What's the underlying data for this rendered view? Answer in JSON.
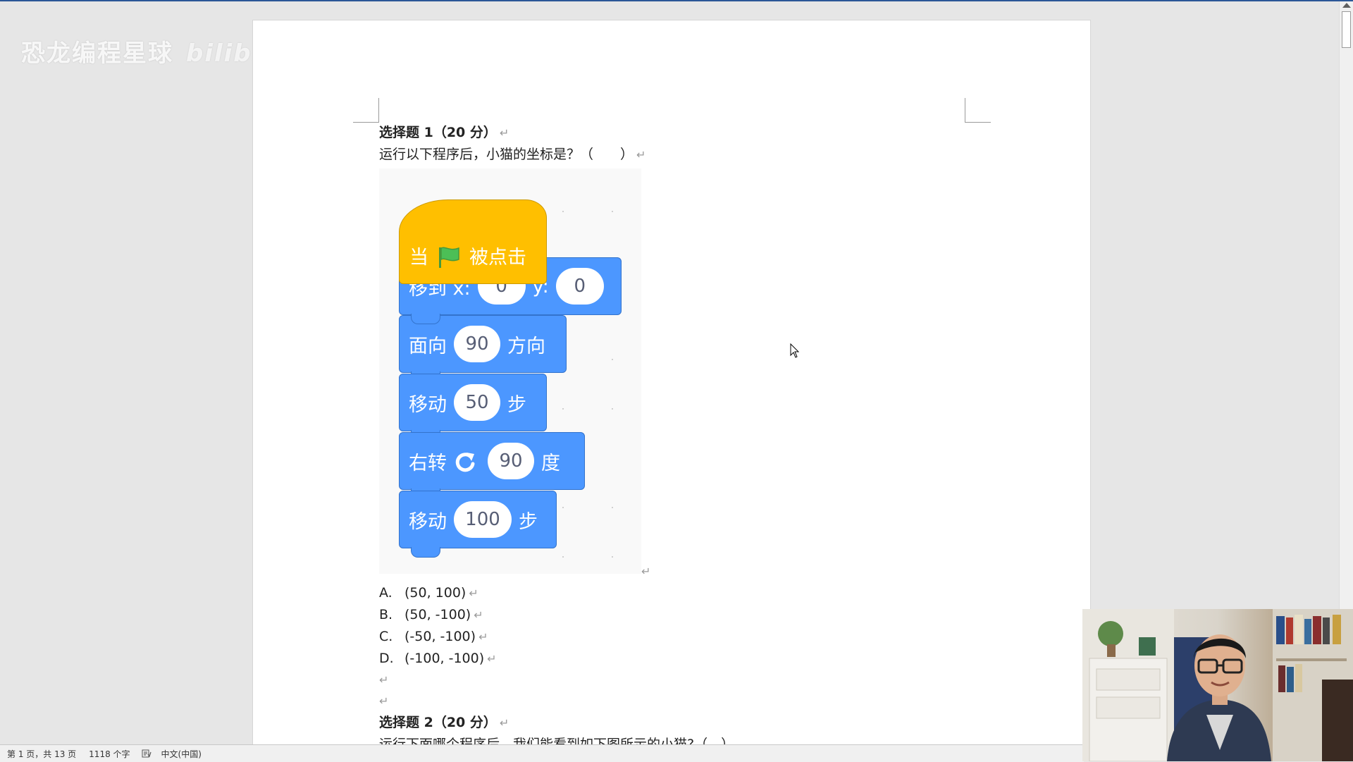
{
  "watermark": {
    "text": "恐龙编程星球",
    "logo": "bilibili"
  },
  "question1": {
    "title": "选择题 1（20 分）",
    "text": "运行以下程序后，小猫的坐标是？（　　）",
    "blocks": {
      "when_flag": {
        "prefix": "当",
        "suffix": "被点击"
      },
      "goto": {
        "label_x": "移到 x:",
        "x": "0",
        "label_y": "y:",
        "y": "0"
      },
      "point": {
        "prefix": "面向",
        "value": "90",
        "suffix": "方向"
      },
      "move1": {
        "prefix": "移动",
        "value": "50",
        "suffix": "步"
      },
      "turn": {
        "prefix": "右转",
        "value": "90",
        "suffix": "度"
      },
      "move2": {
        "prefix": "移动",
        "value": "100",
        "suffix": "步"
      }
    },
    "options": [
      {
        "letter": "A.",
        "text": "(50, 100)"
      },
      {
        "letter": "B.",
        "text": "(50, -100)"
      },
      {
        "letter": "C.",
        "text": "(-50, -100)"
      },
      {
        "letter": "D.",
        "text": "(-100, -100)"
      }
    ]
  },
  "question2": {
    "title": "选择题 2（20 分）",
    "text": "运行下面哪个程序后，我们能看到如下图所示的小猫?（　）"
  },
  "paragraph_mark": "↵",
  "statusbar": {
    "page": "第 1 页，共 13 页",
    "words": "1118 个字",
    "language": "中文(中国)"
  },
  "icons": {
    "green_flag": "flag-icon",
    "turn_right": "rotate-clockwise-icon",
    "doc_check": "proofing-icon",
    "cursor": "mouse-pointer-icon"
  },
  "colors": {
    "event_block": "#ffbf00",
    "motion_block": "#4c97ff",
    "flag": "#4cbf56"
  }
}
